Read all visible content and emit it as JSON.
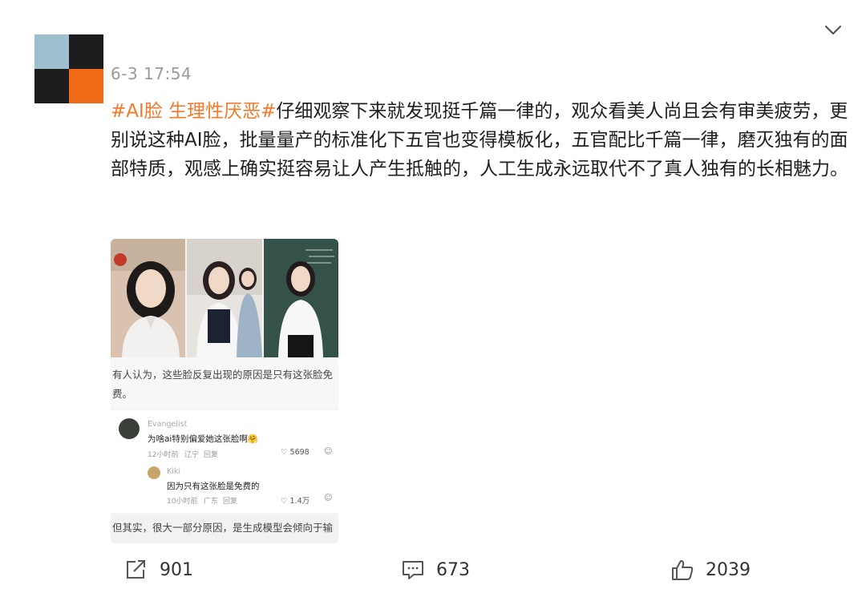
{
  "post": {
    "timestamp": "6-3 17:54",
    "hashtag": "#AI脸 生理性厌恶#",
    "body": "仔细观察下来就发现挺千篇一律的，观众看美人尚且会有审美疲劳，更别说这种AI脸，批量量产的标准化下五官也变得模板化，五官配比千篇一律，磨灭独有的面部特质，观感上确实挺容易让人产生抵触的，人工生成永远取代不了真人独有的长相魅力。"
  },
  "media": {
    "caption_top": "有人认为，这些脸反复出现的原因是只有这张脸免费。",
    "comments": [
      {
        "name": "Evangelist",
        "text": "为啥ai特别偏爱她这张脸啊🤗",
        "time": "12小时前",
        "location": "辽宁",
        "reply": "回复",
        "likes": "5698",
        "emoji": "☺"
      },
      {
        "name": "Kiki",
        "text": "因为只有这张脸是免费的",
        "time": "10小时前",
        "location": "广东",
        "reply": "回复",
        "likes": "1.4万",
        "emoji": "☺"
      }
    ],
    "caption_bottom": "但其实，很大一部分原因，是生成模型会倾向于输"
  },
  "actions": {
    "share_count": "901",
    "comment_count": "673",
    "like_count": "2039"
  },
  "icons": {
    "more": "chevron-down-icon",
    "share": "share-icon",
    "comment": "comment-icon",
    "like": "thumbs-up-icon"
  },
  "colors": {
    "hashtag": "#f37a2a",
    "avatar_blue": "#9cc0ce",
    "avatar_orange": "#f06a17",
    "avatar_dark": "#1c1c1f"
  }
}
